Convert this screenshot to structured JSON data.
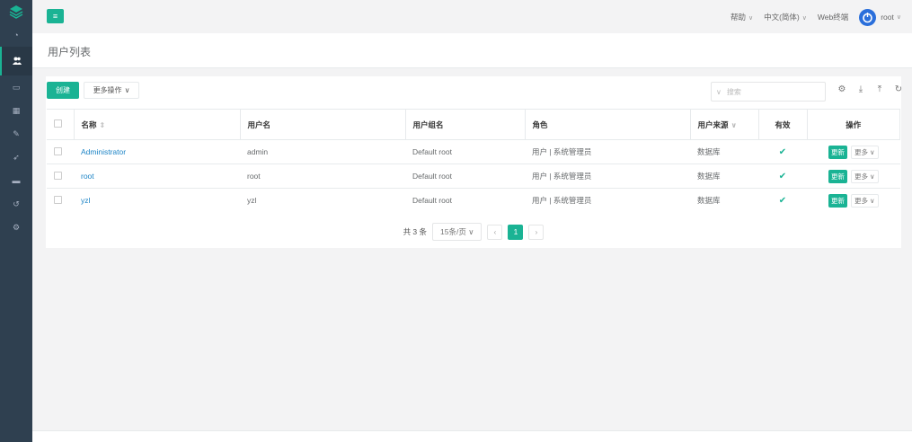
{
  "app": {
    "colors": {
      "accent": "#1ab394",
      "sidebar": "#2f4050",
      "link": "#1c84c6",
      "avatar": "#2a6fdb"
    }
  },
  "sidebar": {
    "items": [
      {
        "icon": "dashboard-icon"
      },
      {
        "icon": "users-icon",
        "active": true
      },
      {
        "icon": "inbox-icon"
      },
      {
        "icon": "grid-icon"
      },
      {
        "icon": "edit-icon"
      },
      {
        "icon": "rocket-icon"
      },
      {
        "icon": "monitor-icon"
      },
      {
        "icon": "history-icon"
      },
      {
        "icon": "settings-icon"
      }
    ]
  },
  "topbar": {
    "help": "帮助",
    "language": "中文(简体)",
    "web_terminal": "Web终端",
    "user": "root"
  },
  "page": {
    "title": "用户列表"
  },
  "toolbar": {
    "create_label": "创建",
    "more_actions_label": "更多操作",
    "search_placeholder": "搜索"
  },
  "table": {
    "headers": {
      "name": "名称",
      "username": "用户名",
      "group": "用户组名",
      "role": "角色",
      "source": "用户来源",
      "valid": "有效",
      "actions": "操作"
    },
    "rows": [
      {
        "name": "Administrator",
        "username": "admin",
        "group": "Default root",
        "role": "用户 | 系统管理员",
        "source": "数据库",
        "valid": true,
        "update": "更新",
        "more": "更多"
      },
      {
        "name": "root",
        "username": "root",
        "group": "Default root",
        "role": "用户 | 系统管理员",
        "source": "数据库",
        "valid": true,
        "update": "更新",
        "more": "更多"
      },
      {
        "name": "yzl",
        "username": "yzl",
        "group": "Default root",
        "role": "用户 | 系统管理员",
        "source": "数据库",
        "valid": true,
        "update": "更新",
        "more": "更多"
      }
    ]
  },
  "pagination": {
    "total": "共 3 条",
    "page_size": "15条/页",
    "current_page": "1"
  }
}
